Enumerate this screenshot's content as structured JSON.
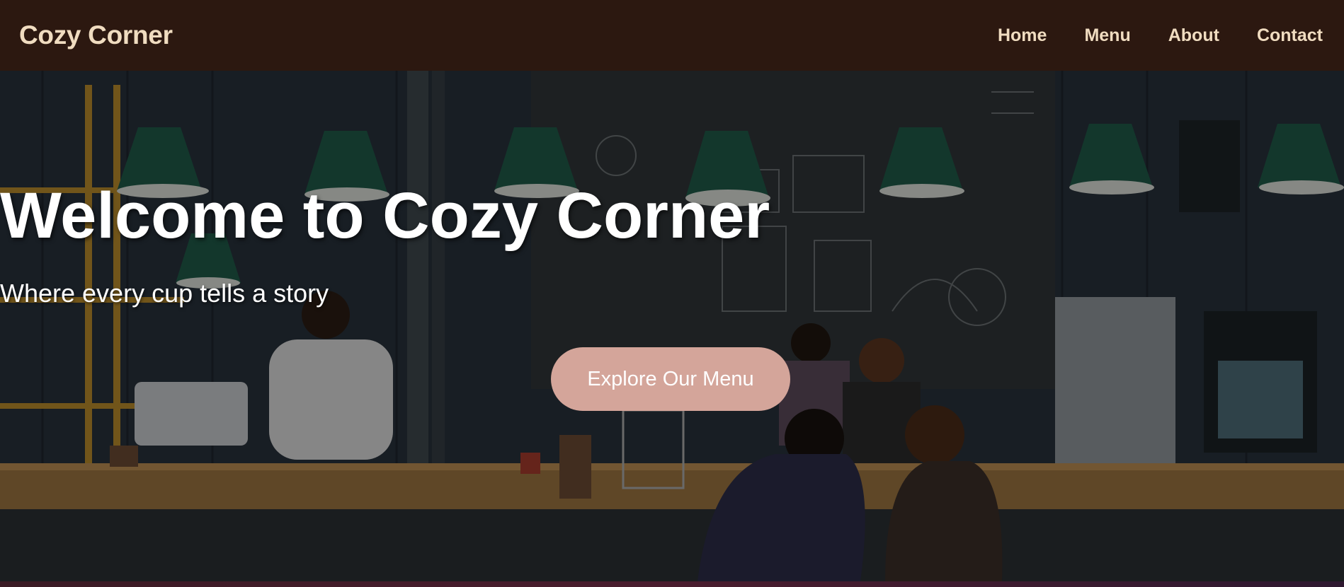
{
  "nav": {
    "logo": "Cozy Corner",
    "links": [
      {
        "label": "Home"
      },
      {
        "label": "Menu"
      },
      {
        "label": "About"
      },
      {
        "label": "Contact"
      }
    ]
  },
  "hero": {
    "title": "Welcome to Cozy Corner",
    "subtitle": "Where every cup tells a story",
    "cta_label": "Explore Our Menu",
    "background_description_icon": "cafe-interior-photo"
  },
  "colors": {
    "nav_bg": "#2c1810",
    "nav_text": "#f0dcc0",
    "cta_bg": "#d4a59a",
    "hero_text": "#ffffff",
    "lamp_green": "#1f5a48"
  }
}
